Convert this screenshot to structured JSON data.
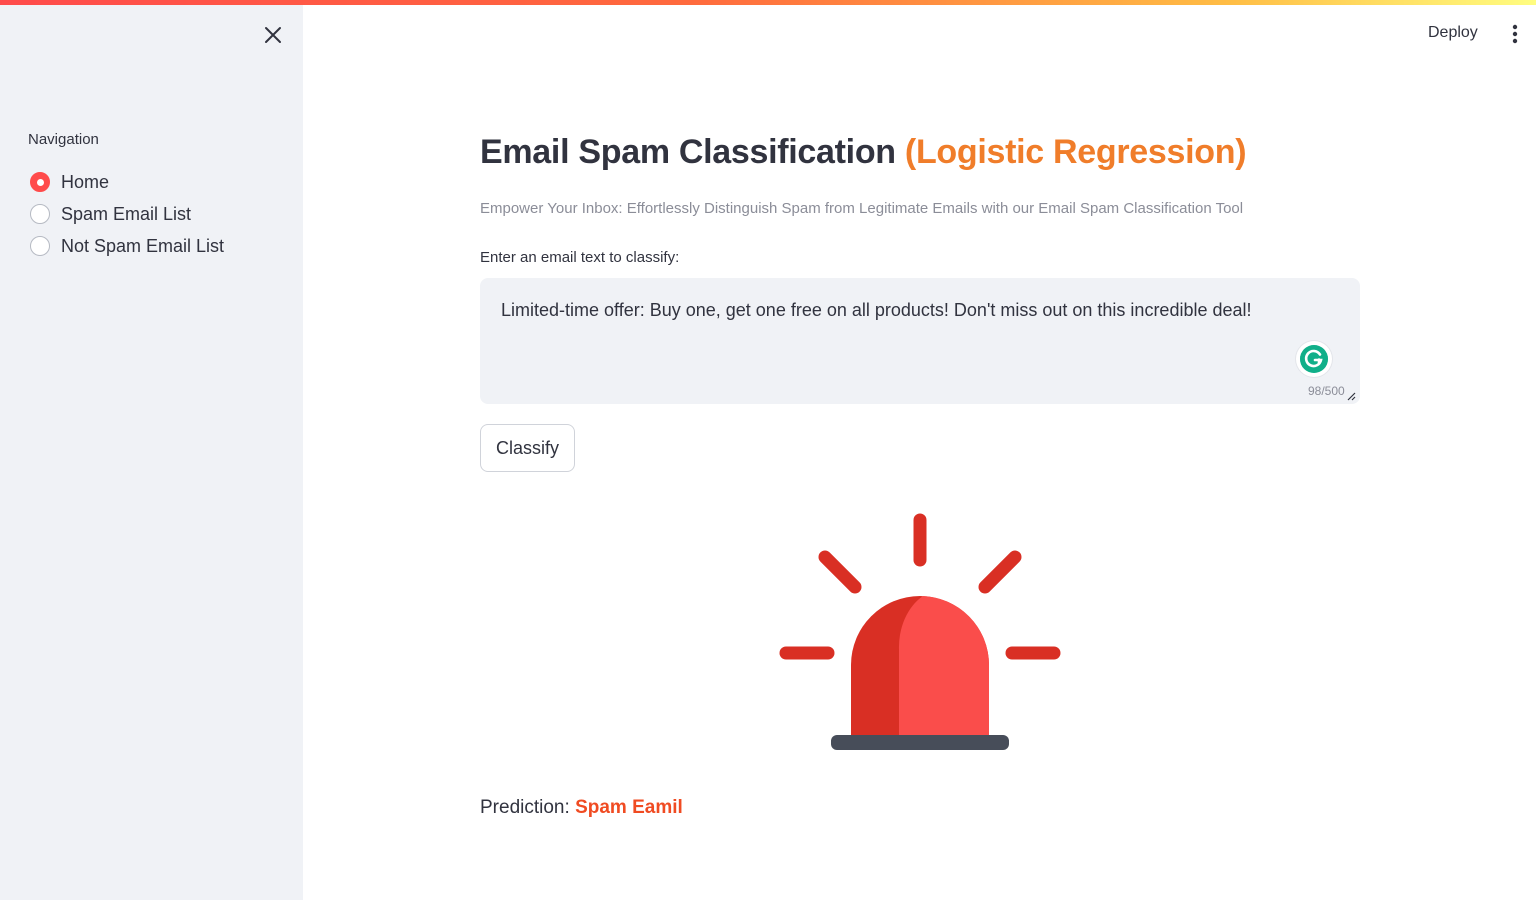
{
  "sidebar": {
    "nav_label": "Navigation",
    "items": [
      {
        "label": "Home",
        "selected": true
      },
      {
        "label": "Spam Email List",
        "selected": false
      },
      {
        "label": "Not Spam Email List",
        "selected": false
      }
    ]
  },
  "header": {
    "deploy_label": "Deploy",
    "menu_icon": "more-vertical-icon"
  },
  "main": {
    "title_main": "Email Spam Classification",
    "title_accent": "(Logistic Regression)",
    "subtitle": "Empower Your Inbox: Effortlessly Distinguish Spam from Legitimate Emails with our Email Spam Classification Tool",
    "input_label": "Enter an email text to classify:",
    "input_value": "Limited-time offer: Buy one, get one free on all products! Don't miss out on this incredible deal!",
    "char_count": "98/500",
    "classify_label": "Classify",
    "prediction_label": "Prediction:",
    "prediction_value": "Spam Eamil",
    "result_icon": "alarm-siren-icon"
  },
  "colors": {
    "accent": "#ff4b4b",
    "title_accent": "#f07d2a",
    "prediction": "#f04b22",
    "sidebar_bg": "#f0f2f6"
  }
}
